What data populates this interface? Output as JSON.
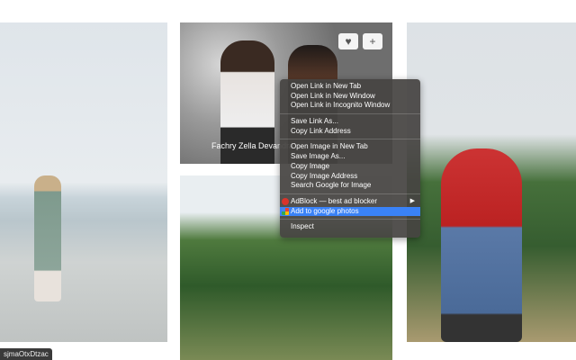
{
  "photos": {
    "second": {
      "credit": "Fachry Zella Devandra",
      "like_icon": "heart-icon",
      "add_icon": "plus-icon",
      "like_label": "♥",
      "add_label": "+"
    }
  },
  "context_menu": {
    "groups": [
      [
        "Open Link in New Tab",
        "Open Link in New Window",
        "Open Link in Incognito Window"
      ],
      [
        "Save Link As...",
        "Copy Link Address"
      ],
      [
        "Open Image in New Tab",
        "Save Image As...",
        "Copy Image",
        "Copy Image Address",
        "Search Google for Image"
      ],
      [
        "AdBlock — best ad blocker",
        "Add to google photos"
      ],
      [
        "Inspect"
      ]
    ],
    "highlighted": "Add to google photos",
    "colors": {
      "highlight": "#3a82f7",
      "adblock": "#d9342b"
    }
  },
  "status_bar": {
    "url": "sjmaOtxDtzac"
  }
}
